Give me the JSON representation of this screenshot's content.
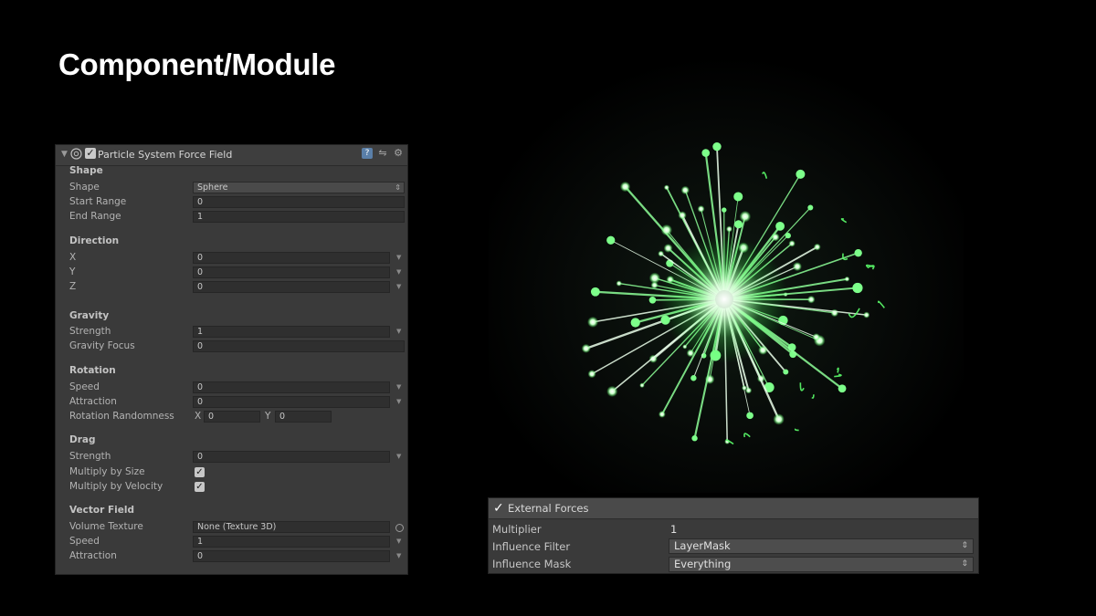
{
  "slide": {
    "title": "Component/Module"
  },
  "inspector": {
    "component_title": "Particle System Force Field",
    "sections": {
      "shape": {
        "heading": "Shape",
        "shape_label": "Shape",
        "shape_value": "Sphere",
        "start_range_label": "Start Range",
        "start_range_value": "0",
        "end_range_label": "End Range",
        "end_range_value": "1"
      },
      "direction": {
        "heading": "Direction",
        "x_label": "X",
        "x_value": "0",
        "y_label": "Y",
        "y_value": "0",
        "z_label": "Z",
        "z_value": "0"
      },
      "gravity": {
        "heading": "Gravity",
        "strength_label": "Strength",
        "strength_value": "1",
        "focus_label": "Gravity Focus",
        "focus_value": "0"
      },
      "rotation": {
        "heading": "Rotation",
        "speed_label": "Speed",
        "speed_value": "0",
        "attraction_label": "Attraction",
        "attraction_value": "0",
        "randomness_label": "Rotation Randomness",
        "rand_x_label": "X",
        "rand_x_value": "0",
        "rand_y_label": "Y",
        "rand_y_value": "0"
      },
      "drag": {
        "heading": "Drag",
        "strength_label": "Strength",
        "strength_value": "0",
        "mult_size_label": "Multiply by Size",
        "mult_velocity_label": "Multiply by Velocity"
      },
      "vector_field": {
        "heading": "Vector Field",
        "volume_label": "Volume Texture",
        "volume_value": "None (Texture 3D)",
        "speed_label": "Speed",
        "speed_value": "1",
        "attraction_label": "Attraction",
        "attraction_value": "0"
      }
    }
  },
  "external_forces": {
    "title": "External Forces",
    "multiplier_label": "Multiplier",
    "multiplier_value": "1",
    "filter_label": "Influence Filter",
    "filter_value": "LayerMask",
    "mask_label": "Influence Mask",
    "mask_value": "Everything"
  },
  "colors": {
    "background": "#000000",
    "panel": "#3a3a3a",
    "particle_glow": "#7dff8a"
  }
}
